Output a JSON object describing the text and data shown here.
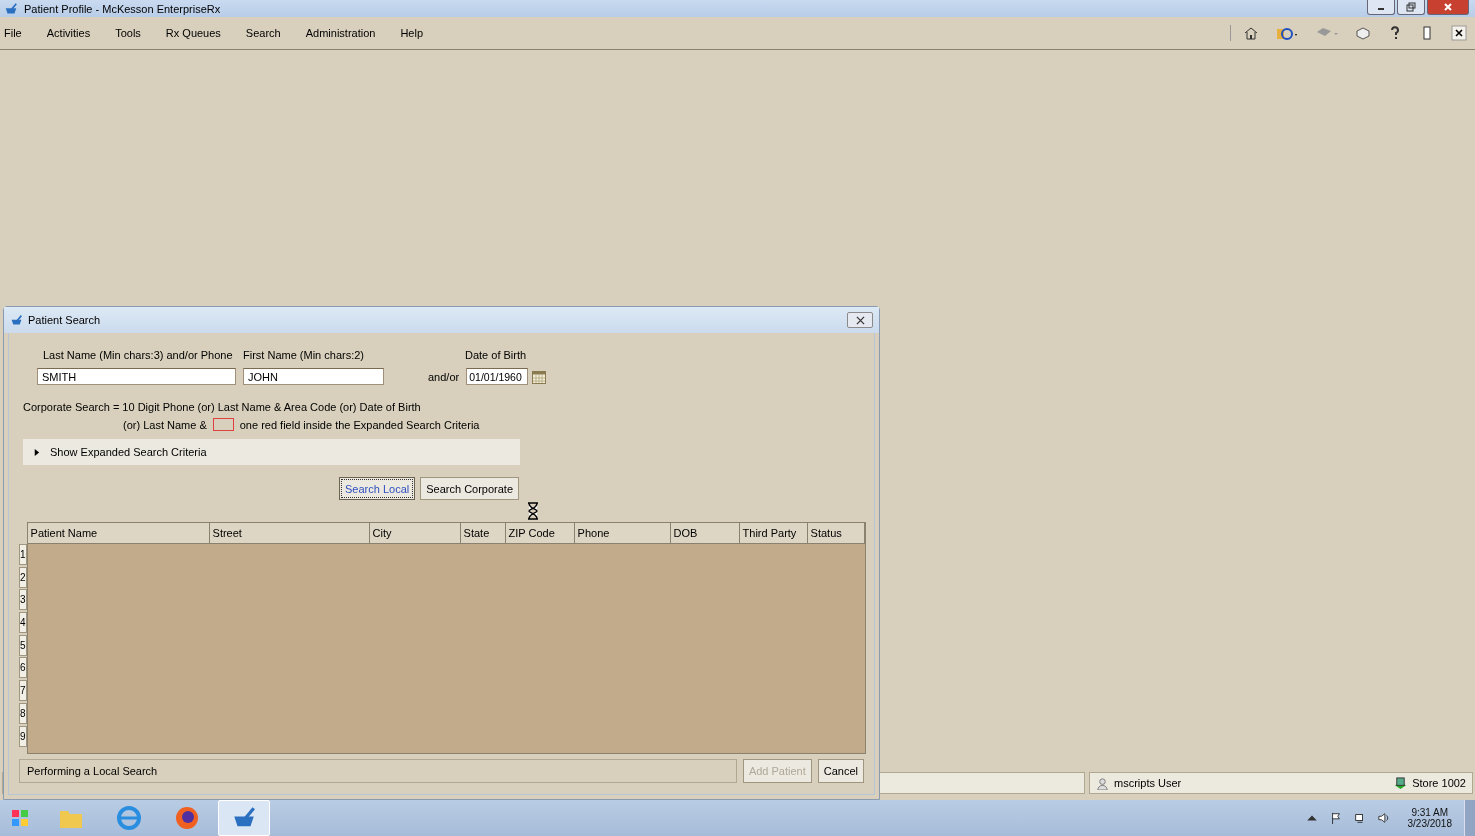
{
  "window": {
    "title": "Patient Profile - McKesson EnterpriseRx"
  },
  "menu": [
    "File",
    "Activities",
    "Tools",
    "Rx Queues",
    "Search",
    "Administration",
    "Help"
  ],
  "dialog": {
    "title": "Patient Search",
    "fields": [
      {
        "label": "Last Name (Min chars:3) and/or Phone",
        "value": "SMITH",
        "kind": "text"
      },
      {
        "label": "First Name (Min chars:2)",
        "value": "JOHN",
        "kind": "text"
      },
      {
        "label": "Date of Birth",
        "value": "01/01/1960",
        "kind": "date"
      }
    ],
    "connector": "and/or",
    "note_line_1": "Corporate Search = 10 Digit Phone (or) Last Name & Area Code (or) Date of Birth",
    "note_line_2_before": "(or) Last Name &",
    "note_line_2_after": "one red field inside the Expanded Search Criteria",
    "expander": {
      "label": "Show Expanded Search Criteria",
      "expanded": false
    },
    "search_buttons": [
      {
        "label": "Search Local",
        "focused": true
      },
      {
        "label": "Search Corporate",
        "focused": false
      }
    ],
    "table": {
      "columns": [
        "Patient Name",
        "Street",
        "City",
        "State",
        "ZIP Code",
        "Phone",
        "DOB",
        "Third Party",
        "Status"
      ],
      "row_numbers": [
        "1",
        "2",
        "3",
        "4",
        "5",
        "6",
        "7",
        "8",
        "9"
      ]
    },
    "status_message": "Performing a Local Search",
    "footer_buttons": [
      {
        "label": "Add Patient",
        "disabled": true
      },
      {
        "label": "Cancel",
        "disabled": false
      }
    ]
  },
  "status_bar": {
    "user": "mscripts User",
    "store": "Store 1002"
  },
  "taskbar": {
    "time": "9:31 AM",
    "date": "3/23/2018"
  }
}
